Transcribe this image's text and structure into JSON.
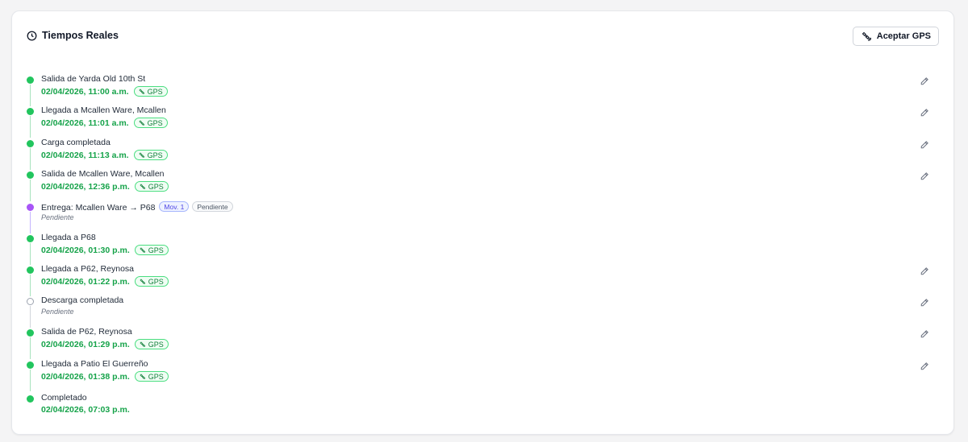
{
  "header": {
    "title": "Tiempos Reales",
    "accept_gps_label": "Aceptar GPS"
  },
  "events": [
    {
      "label": "Salida de Yarda Old 10th St",
      "time": "02/04/2026, 11:00 a.m.",
      "gps": "GPS",
      "status": "done",
      "editable": true
    },
    {
      "label": "Llegada a Mcallen Ware, Mcallen",
      "time": "02/04/2026, 11:01 a.m.",
      "gps": "GPS",
      "status": "done",
      "editable": true
    },
    {
      "label": "Carga completada",
      "time": "02/04/2026, 11:13 a.m.",
      "gps": "GPS",
      "status": "done",
      "editable": true
    },
    {
      "label": "Salida de Mcallen Ware, Mcallen",
      "time": "02/04/2026, 12:36 p.m.",
      "gps": "GPS",
      "status": "done",
      "editable": true
    },
    {
      "label": "Entrega: Mcallen Ware → P68",
      "badge_mov": "Mov. 1",
      "badge_status": "Pendiente",
      "pending_text": "Pendiente",
      "status": "delivery",
      "editable": false
    },
    {
      "label": "Llegada a P68",
      "time": "02/04/2026, 01:30 p.m.",
      "gps": "GPS",
      "status": "done",
      "editable": false
    },
    {
      "label": "Llegada a P62, Reynosa",
      "time": "02/04/2026, 01:22 p.m.",
      "gps": "GPS",
      "status": "done",
      "editable": true
    },
    {
      "label": "Descarga completada",
      "pending_text": "Pendiente",
      "status": "pending",
      "editable": true
    },
    {
      "label": "Salida de P62, Reynosa",
      "time": "02/04/2026, 01:29 p.m.",
      "gps": "GPS",
      "status": "done",
      "editable": true
    },
    {
      "label": "Llegada a Patio El Guerreño",
      "time": "02/04/2026, 01:38 p.m.",
      "gps": "GPS",
      "status": "done",
      "editable": true
    },
    {
      "label": "Completado",
      "time": "02/04/2026, 07:03 p.m.",
      "status": "done",
      "editable": false
    }
  ]
}
